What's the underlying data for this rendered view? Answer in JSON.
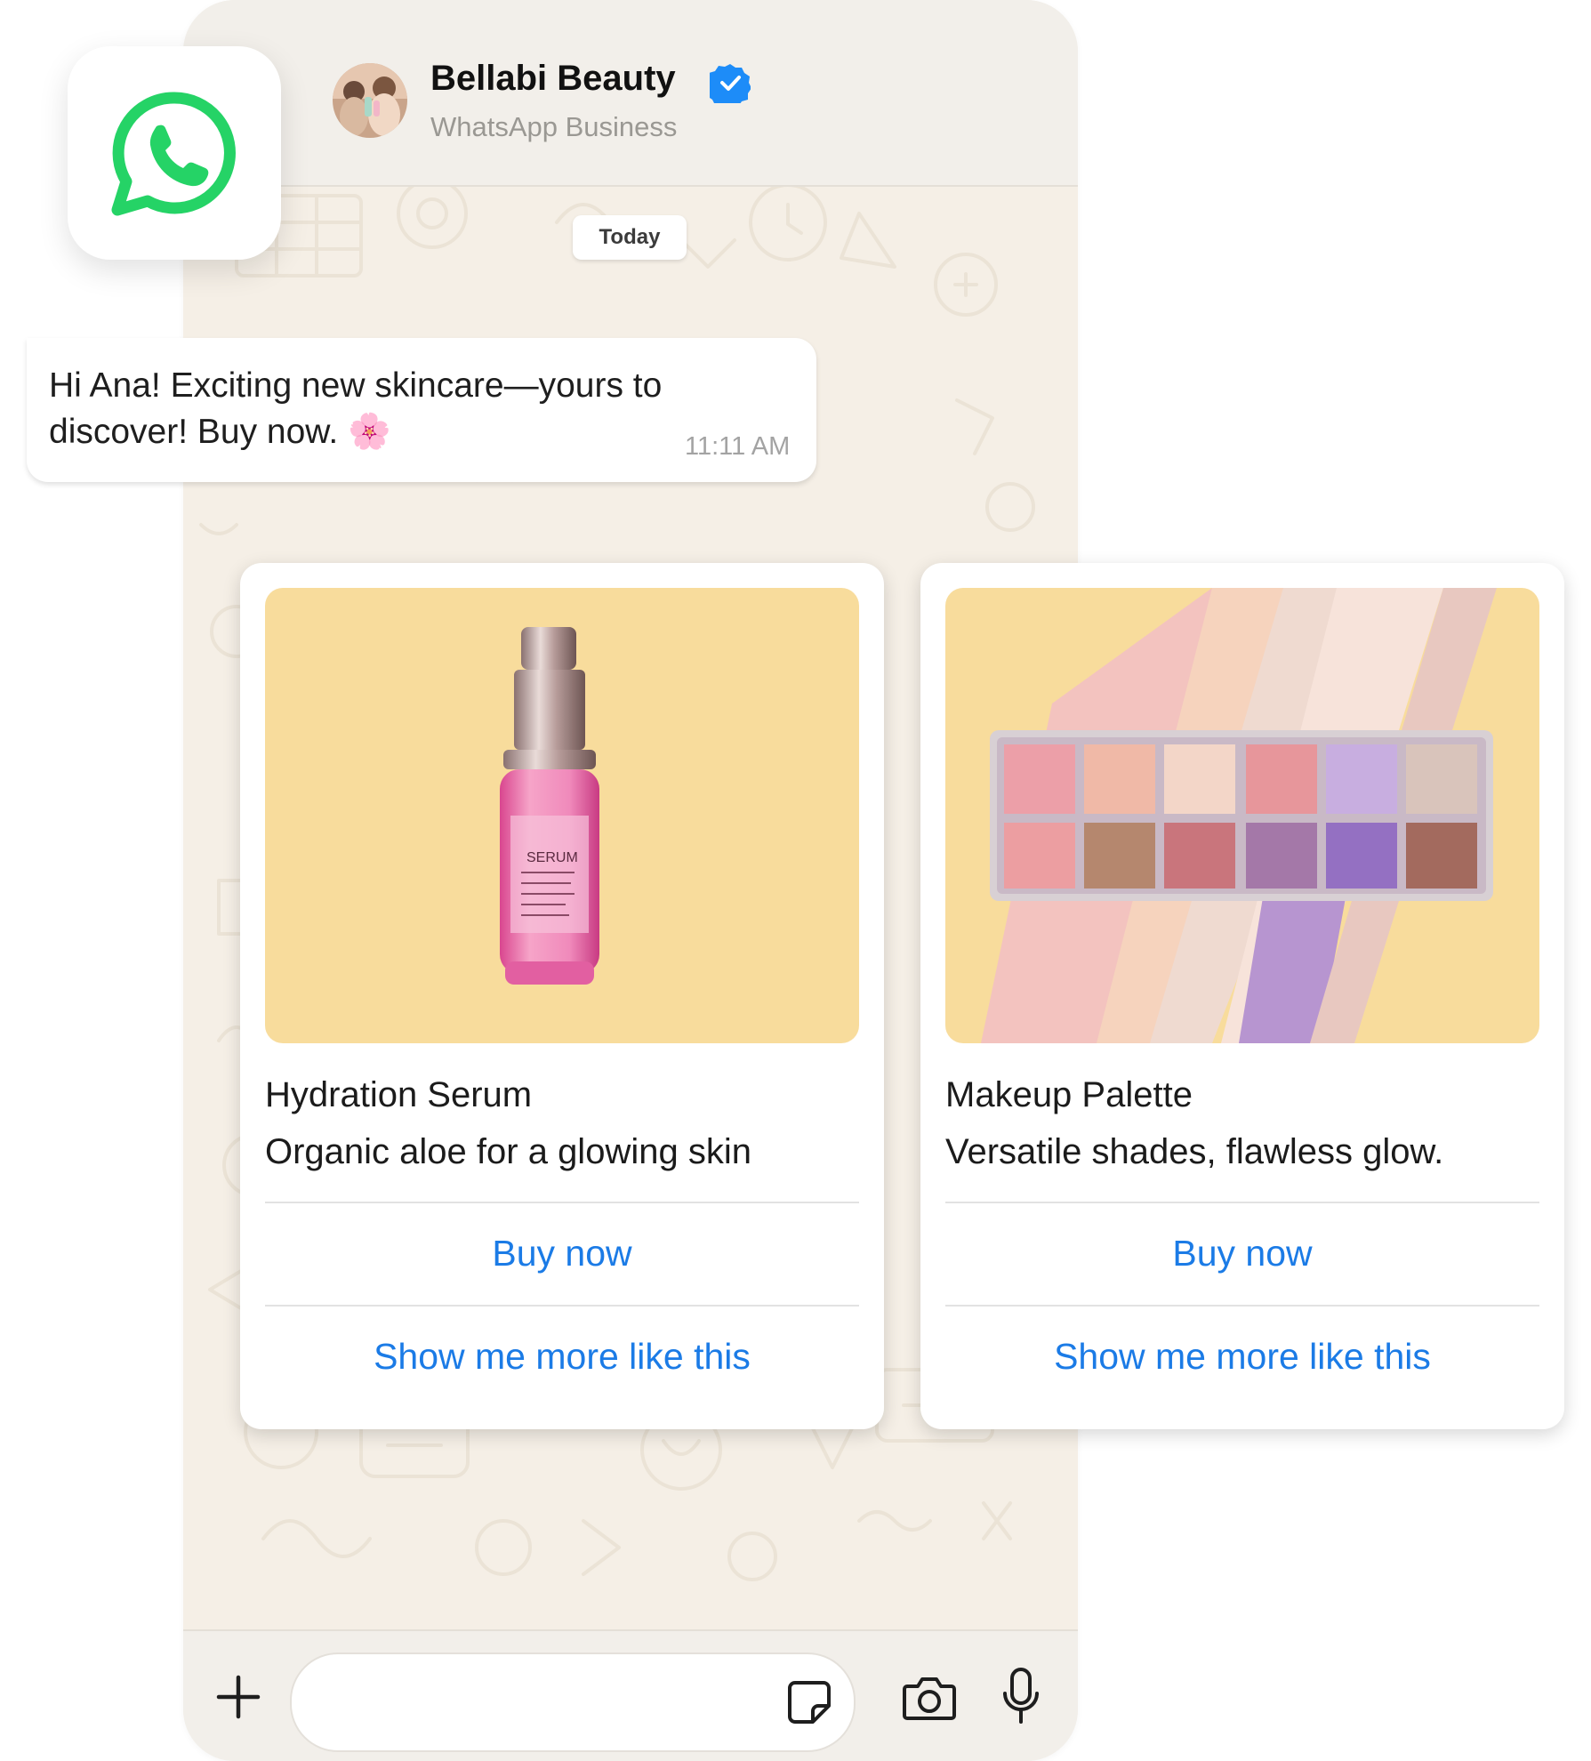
{
  "header": {
    "contact_name": "Bellabi Beauty",
    "contact_subtitle": "WhatsApp Business",
    "verified": true
  },
  "chat": {
    "date_label": "Today",
    "message": {
      "text": "Hi Ana! Exciting new skincare—yours to discover! Buy now. 🌸",
      "time": "11:11 AM"
    }
  },
  "products": [
    {
      "title": "Hydration Serum",
      "description": "Organic aloe for a glowing skin",
      "buy_label": "Buy now",
      "more_label": "Show me more like this"
    },
    {
      "title": "Makeup Palette",
      "description": "Versatile shades, flawless glow.",
      "buy_label": "Buy now",
      "more_label": "Show me more like this"
    }
  ],
  "input_bar": {
    "icons": [
      "plus-icon",
      "sticker-icon",
      "camera-icon",
      "microphone-icon"
    ]
  },
  "colors": {
    "whatsapp_green": "#25d366",
    "link_blue": "#1b7be6",
    "verified_blue": "#1d8cf8",
    "chat_background": "#f5efe6",
    "product_image_background": "#f8dc9c"
  }
}
